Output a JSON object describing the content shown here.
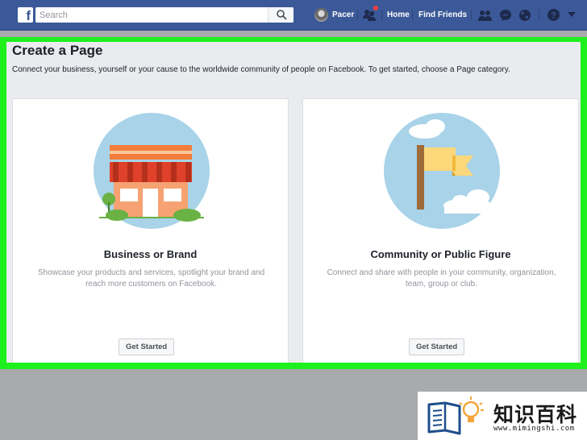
{
  "topbar": {
    "logo_letter": "f",
    "search_placeholder": "Search",
    "profile_name": "Pacer",
    "home_label": "Home",
    "find_friends_label": "Find Friends"
  },
  "main": {
    "title": "Create a Page",
    "subtitle": "Connect your business, yourself or your cause to the worldwide community of people on Facebook. To get started, choose a Page category.",
    "cards": [
      {
        "title": "Business or Brand",
        "description": "Showcase your products and services, spotlight your brand and reach more customers on Facebook.",
        "button_label": "Get Started",
        "icon": "storefront-illustration"
      },
      {
        "title": "Community or Public Figure",
        "description": "Connect and share with people in your community, organization, team, group or club.",
        "button_label": "Get Started",
        "icon": "flag-illustration"
      }
    ]
  },
  "watermark": {
    "text": "知识百科",
    "url": "www.mimingshi.com"
  },
  "colors": {
    "brand_blue": "#3b5998",
    "highlight_green": "#1ef01e",
    "page_background": "#e9ebee"
  }
}
